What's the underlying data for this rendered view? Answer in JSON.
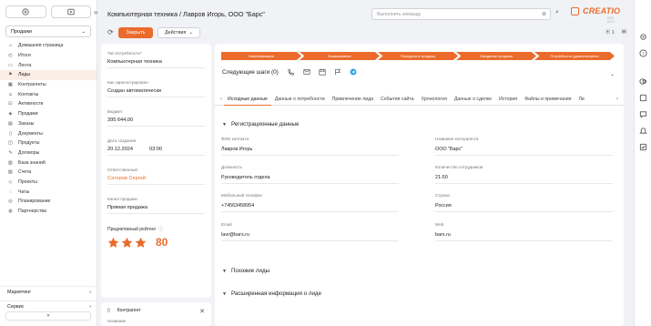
{
  "sidebar": {
    "workspace": "Продажи",
    "items": [
      {
        "label": "Домашняя страница",
        "icon": "home-icon"
      },
      {
        "label": "Итоги",
        "icon": "chart-icon"
      },
      {
        "label": "Лента",
        "icon": "feed-icon"
      },
      {
        "label": "Лиды",
        "icon": "lead-icon",
        "active": true
      },
      {
        "label": "Контрагенты",
        "icon": "building-icon"
      },
      {
        "label": "Контакты",
        "icon": "contact-icon"
      },
      {
        "label": "Активности",
        "icon": "activity-icon"
      },
      {
        "label": "Продажи",
        "icon": "sales-icon"
      },
      {
        "label": "Заказы",
        "icon": "order-icon"
      },
      {
        "label": "Документы",
        "icon": "document-icon"
      },
      {
        "label": "Продукты",
        "icon": "product-icon"
      },
      {
        "label": "Договоры",
        "icon": "contract-icon"
      },
      {
        "label": "База знаний",
        "icon": "knowledge-icon"
      },
      {
        "label": "Счета",
        "icon": "invoice-icon"
      },
      {
        "label": "Проекты",
        "icon": "project-icon"
      },
      {
        "label": "Чаты",
        "icon": "chat-icon"
      },
      {
        "label": "Планирование",
        "icon": "planning-icon"
      },
      {
        "label": "Партнерства",
        "icon": "partner-icon"
      }
    ],
    "groups": [
      "Маркетинг",
      "Сервис"
    ],
    "collapse": "«"
  },
  "header": {
    "title": "Компьютерная техника / Лавров Игорь, ООО \"Барс\"",
    "command_placeholder": "Выполнить команду",
    "logo_text": "CREATIO",
    "logo_sub": "DEV 8.0.0"
  },
  "toolbar": {
    "close_label": "Закрыть",
    "actions_label": "Действия",
    "attachments_count": "1"
  },
  "left_panel": {
    "fields": [
      {
        "label": "Тип потребности*",
        "value": "Компьютерная техника"
      },
      {
        "label": "Как зарегистрирован",
        "value": "Создан автоматически"
      },
      {
        "label": "Бюджет",
        "value": "395 644,00"
      },
      {
        "label": "Дата создания",
        "value": "20.12.2024",
        "time": "03:00"
      },
      {
        "label": "Ответственный",
        "value": "Сатеров Сергей",
        "link": true
      },
      {
        "label": "Канал продажи",
        "value": "Прямая продажа"
      }
    ],
    "rating_label": "Предиктивный рейтинг",
    "rating_stars": 3,
    "rating_value": "80",
    "counterparty_label": "Контрагент",
    "counterparty_sub": "Название"
  },
  "main": {
    "stages": [
      "Квалификация",
      "Взращивание",
      "Передача в продажу",
      "Ожидание продажи",
      "Потребность удовлетворена"
    ],
    "next_steps": "Следующие шаги (0)",
    "tabs": [
      "Исходные данные",
      "Данные о потребности",
      "Привлечение лида",
      "События сайта",
      "Хронология",
      "Данные о сделке",
      "История",
      "Файлы и примечания",
      "Ли"
    ],
    "section_registration": "Регистрационные данные",
    "fields": {
      "fio_label": "ФИО контакта",
      "fio_value": "Лавров Игорь",
      "company_label": "Название контрагента",
      "company_value": "ООО \"Барс\"",
      "position_label": "Должность",
      "position_value": "Руководитель отдела",
      "employees_label": "Количество сотрудников",
      "employees_value": "21-50",
      "phone_label": "Мобильный телефон",
      "phone_value": "+74563458954",
      "country_label": "Страна",
      "country_value": "Россия",
      "email_label": "Email",
      "email_value": "lavr@bars.ru",
      "web_label": "Web",
      "web_value": "bars.ru"
    },
    "section_similar": "Похожие лиды",
    "section_extended": "Расширенная информация о лиде"
  },
  "colors": {
    "accent": "#ea6b2c",
    "active_bg": "#fbeee6"
  }
}
